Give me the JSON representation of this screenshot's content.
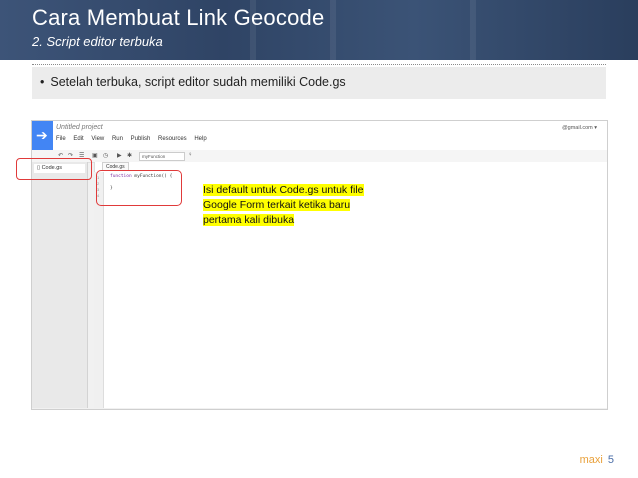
{
  "slide": {
    "title": "Cara Membuat Link Geocode",
    "subtitle": "2. Script editor terbuka",
    "bullet": "Setelah terbuka, script editor sudah memiliki Code.gs",
    "brand": "maxi",
    "page_number": "5",
    "colors": {
      "header": "#2f4465",
      "annotation": "#e03a3a",
      "highlight": "#ffff00"
    }
  },
  "editor": {
    "project_name": "Untitled project",
    "menus": [
      "File",
      "Edit",
      "View",
      "Run",
      "Publish",
      "Resources",
      "Help"
    ],
    "account": "@gmail.com ▾",
    "function_select": "myFunction",
    "file_item": "Code.gs",
    "tab_label": "Code.gs",
    "line_numbers": [
      "1",
      "2",
      "3",
      "4"
    ],
    "code_line1_kw": "function",
    "code_line1_rest": " myFunction() {",
    "code_line2": "}",
    "icons": [
      "undo-icon",
      "redo-icon",
      "indent-icon",
      "save-icon",
      "trigger-icon",
      "run-icon",
      "debug-icon",
      "lightbulb-icon"
    ]
  },
  "annotation": {
    "lines": [
      "Isi default untuk Code.gs untuk file",
      "Google Form terkait ketika baru",
      "pertama kali dibuka"
    ]
  }
}
